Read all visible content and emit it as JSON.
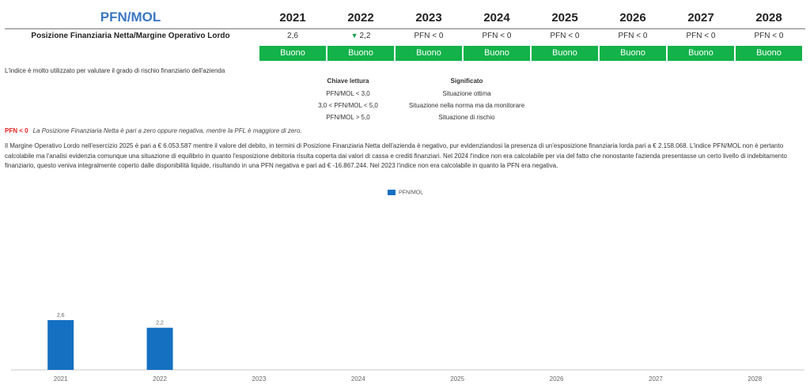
{
  "header": {
    "title": "PFN/MOL",
    "years": [
      "2021",
      "2022",
      "2023",
      "2024",
      "2025",
      "2026",
      "2027",
      "2028"
    ]
  },
  "indicator": {
    "label": "Posizione Finanziaria Netta/Margine Operativo Lordo",
    "values": [
      "2,6",
      "2,2",
      "PFN < 0",
      "PFN < 0",
      "PFN < 0",
      "PFN < 0",
      "PFN < 0",
      "PFN < 0"
    ],
    "trend_marker": "▼",
    "trend_color": "#17a34a",
    "ratings": [
      "Buono",
      "Buono",
      "Buono",
      "Buono",
      "Buono",
      "Buono",
      "Buono",
      "Buono"
    ],
    "rating_color": "#13b24a"
  },
  "intro_text": "L'indice è molto utilizzato per valutare il grado di rischio finanziario dell'azienda",
  "key_table": {
    "headers": [
      "Chiave lettura",
      "Significato"
    ],
    "rows": [
      [
        "PFN/MOL < 3,0",
        "Situazione ottima"
      ],
      [
        "3,0 < PFN/MOL < 5,0",
        "Situazione nella norma ma da monitorare"
      ],
      [
        "PFN/MOL > 5,0",
        "Situazione di rischio"
      ]
    ]
  },
  "pfn_note": {
    "tag": "PFN < 0",
    "text": "La Posizione Finanziaria Netta è pari a zero oppure negativa, mentre la PFL è maggiore di zero."
  },
  "analysis_text": "Il Margine Operativo Lordo nell'esercizio 2025 è pari a € 6.053.587 mentre il valore del debito, in termini di Posizione Finanziaria Netta dell'azienda è negativo, pur evidenziandosi la presenza di un'esposizione finanziaria lorda pari a € 2.158.068. L'indice PFN/MOL non è pertanto calcolabile ma l'analisi evidenzia comunque una situazione di equilibrio in quanto l'esposizione debitoria risulta coperta dai valori di cassa e crediti finanziari. Nel 2024 l'indice non era calcolabile per via del fatto che nonostante l'azienda presentasse un certo livello di indebitamento finanziario, questo veniva integralmente coperto dalle disponibilità liquide, risultando in una PFN negativa e pari ad € -16.867.244. Nel 2023 l'indice non era calcolabile in quanto la PFN era negativa.",
  "chart_data": {
    "type": "bar",
    "categories": [
      "2021",
      "2022",
      "2023",
      "2024",
      "2025",
      "2026",
      "2027",
      "2028"
    ],
    "series": [
      {
        "name": "PFN/MOL",
        "values": [
          2.6,
          2.2,
          null,
          null,
          null,
          null,
          null,
          null
        ],
        "labels": [
          "2,6",
          "2,2",
          "",
          "",
          "",
          "",
          "",
          ""
        ],
        "color": "#1570c2"
      }
    ],
    "ylim": [
      0,
      9
    ],
    "legend": "top-center",
    "grid": false
  }
}
